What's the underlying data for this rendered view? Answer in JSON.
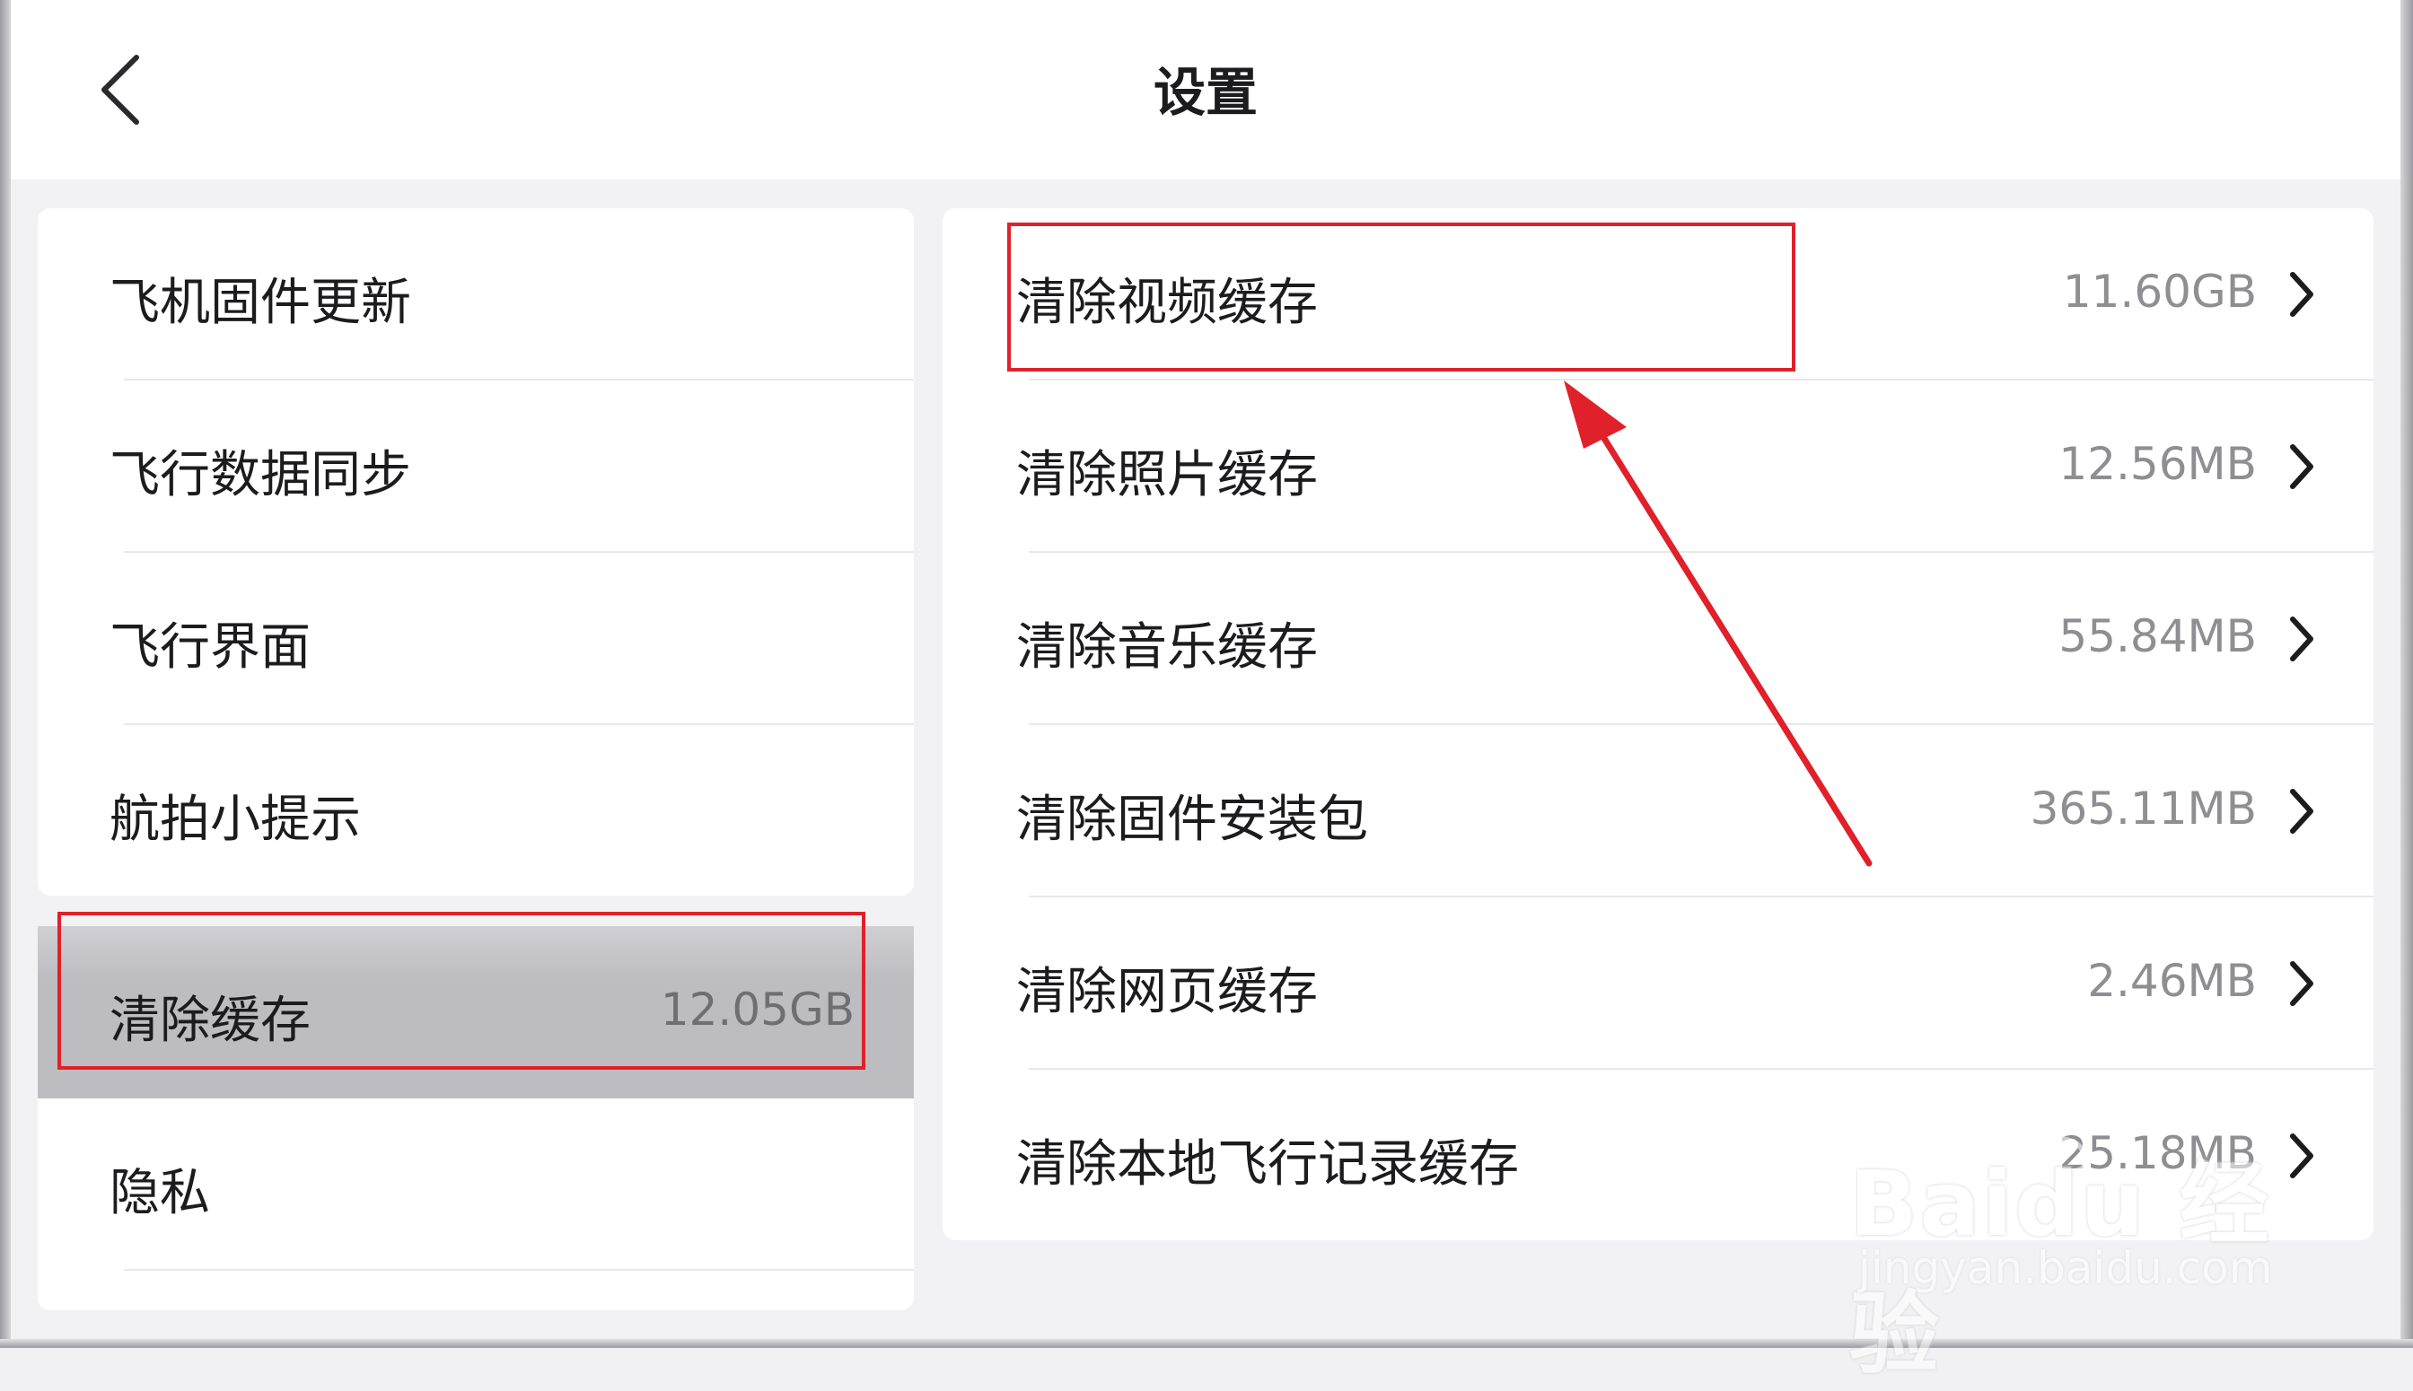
{
  "header": {
    "title": "设置"
  },
  "left_menu": {
    "items": [
      {
        "label": "飞机固件更新"
      },
      {
        "label": "飞行数据同步"
      },
      {
        "label": "飞行界面"
      },
      {
        "label": "航拍小提示"
      }
    ],
    "selected": {
      "label": "清除缓存",
      "value": "12.05GB"
    },
    "bottom_items": [
      {
        "label": "隐私"
      }
    ]
  },
  "right_menu": {
    "items": [
      {
        "label": "清除视频缓存",
        "value": "11.60GB"
      },
      {
        "label": "清除照片缓存",
        "value": "12.56MB"
      },
      {
        "label": "清除音乐缓存",
        "value": "55.84MB"
      },
      {
        "label": "清除固件安装包",
        "value": "365.11MB"
      },
      {
        "label": "清除网页缓存",
        "value": "2.46MB"
      },
      {
        "label": "清除本地飞行记录缓存",
        "value": "25.18MB"
      }
    ]
  },
  "watermark": {
    "main": "Baidu 经验",
    "sub": "jingyan.baidu.com"
  },
  "colors": {
    "annotation_red": "#e0202a",
    "selected_bg": "#bdbdc1",
    "value_gray": "#8e8e93"
  },
  "icons": {
    "back": "chevron-left-icon",
    "row": "chevron-right-icon"
  }
}
